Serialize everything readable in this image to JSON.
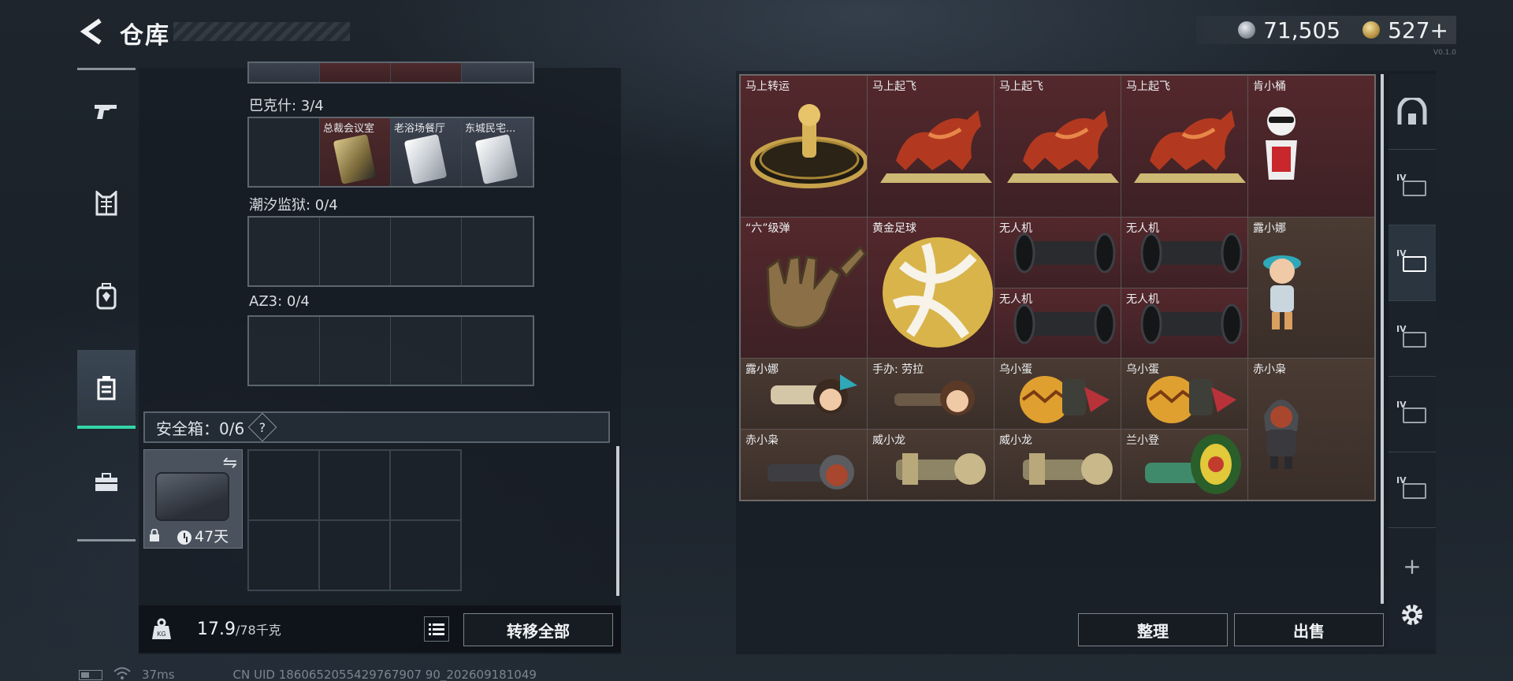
{
  "header": {
    "title": "仓库",
    "currency_silver": "71,505",
    "currency_gold": "527+",
    "version": "V0.1.0"
  },
  "left_nav": [
    "weapons-icon",
    "armor-icon",
    "backpack-icon",
    "container-icon",
    "case-icon"
  ],
  "left_groups": [
    {
      "label": "巴克什: 3/4",
      "slots": [
        "",
        "总裁会议室",
        "老浴场餐厅",
        "东城民宅..."
      ]
    },
    {
      "label": "潮汐监狱: 0/4",
      "slots": [
        "",
        "",
        "",
        ""
      ]
    },
    {
      "label": "AZ3: 0/4",
      "slots": [
        "",
        "",
        "",
        ""
      ]
    }
  ],
  "safebox": {
    "title": "安全箱：0/6",
    "help": "?",
    "days": "47天"
  },
  "weight": {
    "current": "17.9",
    "max": "/78千克"
  },
  "buttons": {
    "transfer_all": "转移全部",
    "sort": "整理",
    "sell": "出售"
  },
  "grid_items": {
    "r1": [
      "马上转运",
      "马上起飞",
      "马上起飞",
      "马上起飞",
      "肯小桶"
    ],
    "r2": [
      "“六”级弹",
      "黄金足球",
      "无人机",
      "无人机",
      "露小娜"
    ],
    "r2b": [
      "无人机",
      "无人机"
    ],
    "r3": [
      "露小娜",
      "手办: 劳拉",
      "乌小蛋",
      "乌小蛋",
      "赤小枭"
    ],
    "r4": [
      "赤小枭",
      "威小龙",
      "威小龙",
      "兰小登"
    ]
  },
  "right_rail": [
    "home-icon",
    "tag-iv-1",
    "tag-iv-2",
    "tag-iv-3",
    "tag-iv-4",
    "tag-iv-5"
  ],
  "rail_tag_text": "IV",
  "status": {
    "ping": "37ms",
    "uid": "CN UID 1860652055429767907 90_202609181049"
  },
  "colors": {
    "accent": "#33d6a6",
    "red_rarity": "#54282c",
    "gold_rarity": "#4a3b33"
  }
}
